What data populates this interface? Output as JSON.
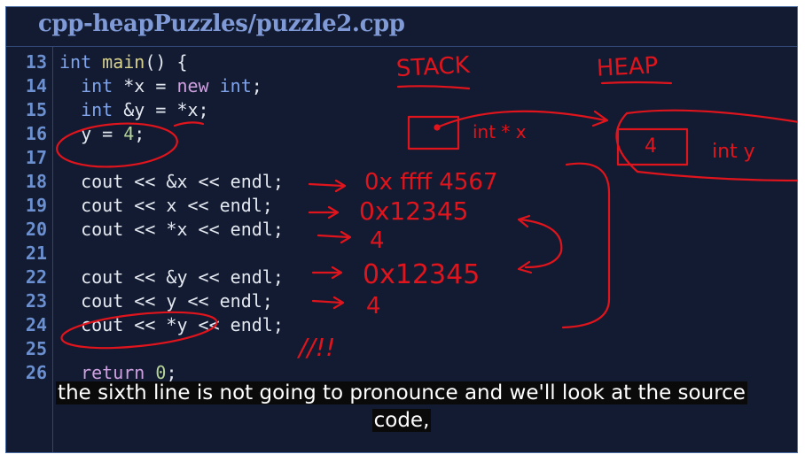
{
  "window": {
    "title": "cpp-heapPuzzles/puzzle2.cpp"
  },
  "code": {
    "lines": [
      {
        "num": "13",
        "tokens": [
          {
            "t": "int",
            "c": "kw"
          },
          {
            "t": " "
          },
          {
            "t": "main",
            "c": "fn"
          },
          {
            "t": "() {"
          }
        ]
      },
      {
        "num": "14",
        "tokens": [
          {
            "t": "  "
          },
          {
            "t": "int",
            "c": "kw"
          },
          {
            "t": " *x = "
          },
          {
            "t": "new",
            "c": "new"
          },
          {
            "t": " "
          },
          {
            "t": "int",
            "c": "kw"
          },
          {
            "t": ";"
          }
        ]
      },
      {
        "num": "15",
        "tokens": [
          {
            "t": "  "
          },
          {
            "t": "int",
            "c": "kw"
          },
          {
            "t": " &y = *x;"
          }
        ]
      },
      {
        "num": "16",
        "tokens": [
          {
            "t": "  y = "
          },
          {
            "t": "4",
            "c": "num"
          },
          {
            "t": ";"
          }
        ]
      },
      {
        "num": "17",
        "tokens": []
      },
      {
        "num": "18",
        "tokens": [
          {
            "t": "  cout << &x << endl;"
          }
        ]
      },
      {
        "num": "19",
        "tokens": [
          {
            "t": "  cout << x << endl;"
          }
        ]
      },
      {
        "num": "20",
        "tokens": [
          {
            "t": "  cout << *x << endl;"
          }
        ]
      },
      {
        "num": "21",
        "tokens": []
      },
      {
        "num": "22",
        "tokens": [
          {
            "t": "  cout << &y << endl;"
          }
        ]
      },
      {
        "num": "23",
        "tokens": [
          {
            "t": "  cout << y << endl;"
          }
        ]
      },
      {
        "num": "24",
        "tokens": [
          {
            "t": "  cout << *y << endl;"
          }
        ]
      },
      {
        "num": "25",
        "tokens": []
      },
      {
        "num": "26",
        "tokens": [
          {
            "t": "  "
          },
          {
            "t": "return",
            "c": "new"
          },
          {
            "t": " "
          },
          {
            "t": "0",
            "c": "num"
          },
          {
            "t": ";"
          }
        ]
      }
    ]
  },
  "annotations": {
    "stack_label": "STACK",
    "heap_label": "HEAP",
    "stack_box_label": "int * x",
    "heap_box_value": "4",
    "heap_box_label": "int y",
    "out_18": "0x ffff 4567",
    "out_19": "0x12345",
    "out_20": "4",
    "out_22": "0x12345",
    "out_23": "4",
    "out_24": "//!!",
    "ink_color": "#e0141c"
  },
  "caption": {
    "line1": "the sixth line is not going to pronounce and we'll look at the source",
    "line2": "code,"
  },
  "colors": {
    "background": "#121b31",
    "title": "#7f9ad6",
    "line_numbers": "#6b8fcf",
    "keyword": "#7fa4ec",
    "function": "#d9d28c",
    "new_keyword": "#cfa0e0",
    "number": "#b6d49a",
    "text": "#e4e8f1"
  }
}
